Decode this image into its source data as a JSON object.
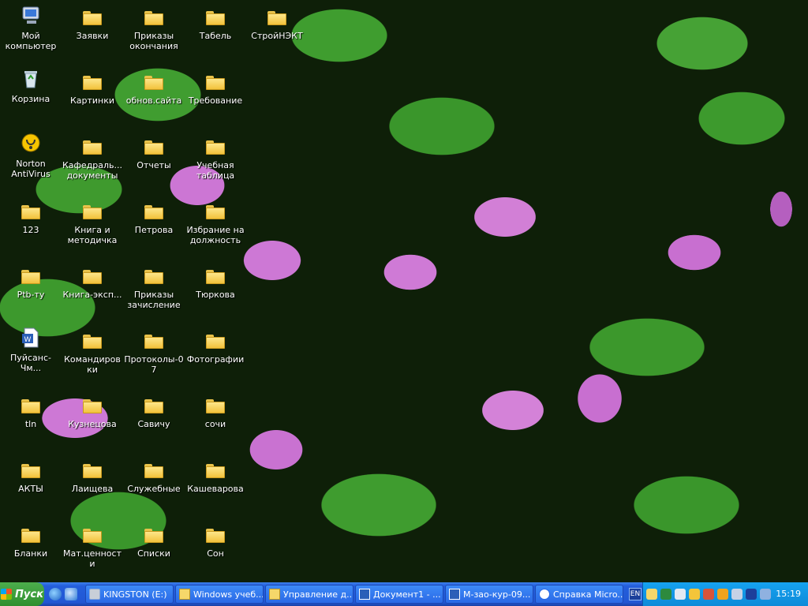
{
  "desktop": {
    "icons": [
      {
        "label": "Мой компьютер",
        "icon": "my-computer-icon"
      },
      {
        "label": "Заявки",
        "icon": "folder-icon"
      },
      {
        "label": "Приказы окончания",
        "icon": "folder-icon"
      },
      {
        "label": "Табель",
        "icon": "folder-icon"
      },
      {
        "label": "СтройНЭКТ",
        "icon": "folder-icon"
      },
      {
        "label": "Корзина",
        "icon": "recycle-bin-icon"
      },
      {
        "label": "Картинки",
        "icon": "folder-icon"
      },
      {
        "label": "обнов.сайта",
        "icon": "folder-icon"
      },
      {
        "label": "Требование",
        "icon": "folder-icon"
      },
      {
        "label": "Norton AntiVirus",
        "icon": "norton-antivirus-icon"
      },
      {
        "label": "Кафедраль... документы",
        "icon": "folder-icon"
      },
      {
        "label": "Отчеты",
        "icon": "folder-icon"
      },
      {
        "label": "Учебная таблица",
        "icon": "folder-icon"
      },
      {
        "label": "123",
        "icon": "folder-icon"
      },
      {
        "label": "Книга и методичка",
        "icon": "folder-icon"
      },
      {
        "label": "Петрова",
        "icon": "folder-icon"
      },
      {
        "label": "Избрание на должность",
        "icon": "folder-icon"
      },
      {
        "label": "Ptb-ту",
        "icon": "folder-icon"
      },
      {
        "label": "Книга-эксп...",
        "icon": "folder-icon"
      },
      {
        "label": "Приказы зачисление",
        "icon": "folder-icon"
      },
      {
        "label": "Тюркова",
        "icon": "folder-icon"
      },
      {
        "label": "Пуйсанс-Чм...",
        "icon": "word-document-icon"
      },
      {
        "label": "Командировки",
        "icon": "folder-icon"
      },
      {
        "label": "Протоколы-07",
        "icon": "folder-icon"
      },
      {
        "label": "Фотографии",
        "icon": "folder-icon"
      },
      {
        "label": "tln",
        "icon": "folder-icon"
      },
      {
        "label": "Кузнецова",
        "icon": "folder-icon"
      },
      {
        "label": "Савичу",
        "icon": "folder-icon"
      },
      {
        "label": "сочи",
        "icon": "folder-icon"
      },
      {
        "label": "АКТЫ",
        "icon": "folder-icon"
      },
      {
        "label": "Лаищева",
        "icon": "folder-icon"
      },
      {
        "label": "Служебные",
        "icon": "folder-icon"
      },
      {
        "label": "Кашеварова",
        "icon": "folder-icon"
      },
      {
        "label": "Бланки",
        "icon": "folder-icon"
      },
      {
        "label": "Мат.ценности",
        "icon": "folder-icon"
      },
      {
        "label": "Списки",
        "icon": "folder-icon"
      },
      {
        "label": "Сон",
        "icon": "folder-icon"
      }
    ]
  },
  "taskbar": {
    "start_label": "Пуск",
    "quick_launch": [
      "internet-explorer-icon",
      "show-desktop-icon"
    ],
    "tasks": [
      {
        "label": "KINGSTON (E:)",
        "icon": "drive-icon"
      },
      {
        "label": "Windows учеб...",
        "icon": "folder-window-icon"
      },
      {
        "label": "Управление д...",
        "icon": "folder-window-icon"
      },
      {
        "label": "Документ1 - ...",
        "icon": "word-icon"
      },
      {
        "label": "М-зао-кур-09...",
        "icon": "word-icon"
      },
      {
        "label": "Справка Micro...",
        "icon": "help-icon"
      }
    ],
    "language": "EN",
    "clock": "15:19"
  }
}
